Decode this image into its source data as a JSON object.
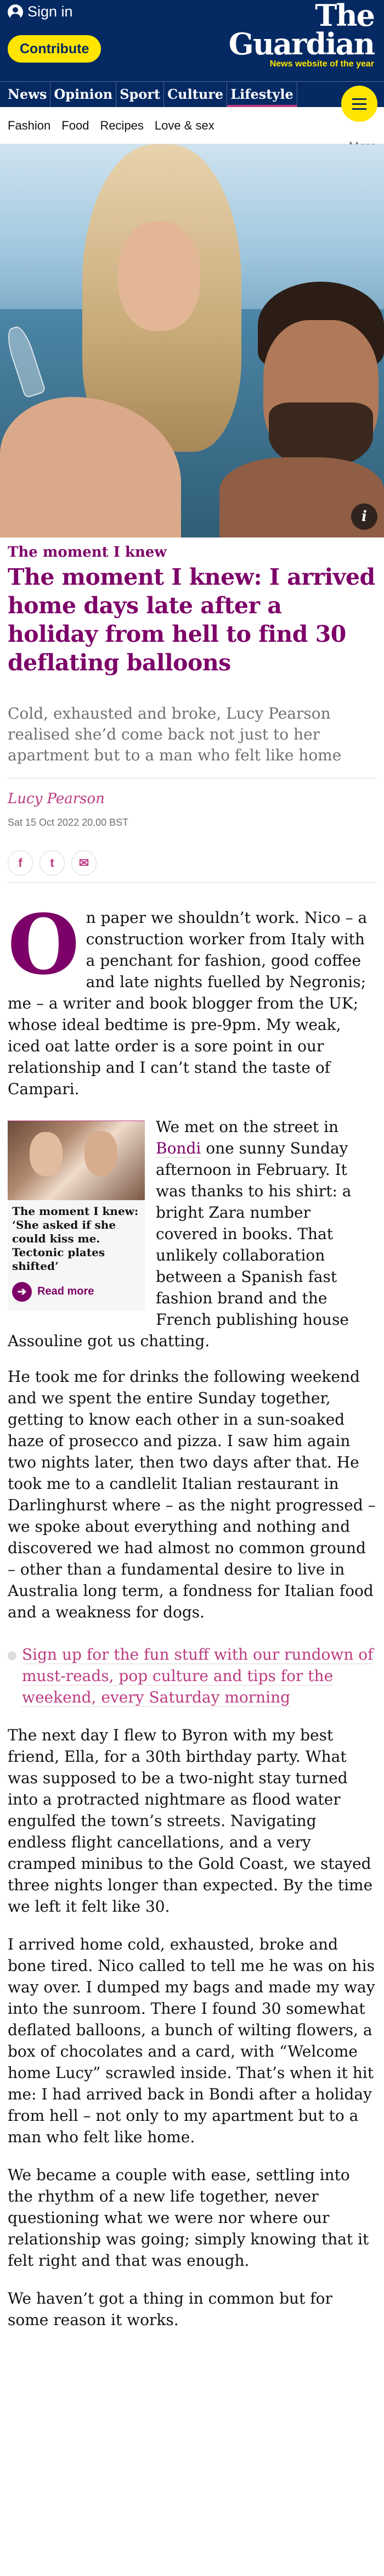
{
  "header": {
    "signin_label": "Sign in",
    "contribute_label": "Contribute",
    "logo_line1": "The",
    "logo_line2": "Guardian",
    "logo_tagline": "News website of the year",
    "nav": [
      "News",
      "Opinion",
      "Sport",
      "Culture",
      "Lifestyle"
    ],
    "active_nav": "Lifestyle",
    "subnav": [
      "Fashion",
      "Food",
      "Recipes",
      "Love & sex"
    ],
    "subnav_more": "More",
    "colors": {
      "brand": "#052962",
      "accent": "#ffe500",
      "lifestyle": "#7d0068"
    }
  },
  "hero": {
    "info_icon": "i"
  },
  "article": {
    "kicker": "The moment I knew",
    "headline": "The moment I knew: I arrived home days late after a holiday from hell to find 30 deflating balloons",
    "standfirst": "Cold, exhausted and broke, Lucy Pearson realised she’d come back not just to her apartment but to a man who felt like home",
    "byline": "Lucy Pearson",
    "date": "Sat 15 Oct 2022 20.00 BST",
    "share_icons": [
      "f",
      "t",
      "✉"
    ],
    "dropcap": "O",
    "p1": "n paper we shouldn’t work. Nico – a construction worker from Italy with a penchant for fashion, good coffee and late nights fuelled by Negronis; me – a writer and book blogger from the UK; whose ideal bedtime is pre-9pm. My weak, iced oat latte order is a sore point in our relationship and I can’t stand the taste of Campari.",
    "rich_link": {
      "title": "The moment I knew: ‘She asked if she could kiss me. Tectonic plates shifted’",
      "more": "Read more"
    },
    "p2_before": "We met on the street in ",
    "p2_link": "Bondi",
    "p2_after": " one sunny Sunday afternoon in February. It was thanks to his shirt: a bright Zara number covered in books. That unlikely collaboration between a Spanish fast fashion brand and the French publishing house Assouline got us chatting.",
    "p3": "He took me for drinks the following weekend and we spent the entire Sunday together, getting to know each other in a sun-soaked haze of prosecco and pizza. I saw him again two nights later, then two days after that. He took me to a candlelit Italian restaurant in Darlinghurst where – as the night progressed – we spoke about everything and nothing and discovered we had almost no common ground – other than a fundamental desire to live in Australia long term, a fondness for Italian food and a weakness for dogs.",
    "signup": "Sign up for the fun stuff with our rundown of must-reads, pop culture and tips for the weekend, every Saturday morning",
    "p4": "The next day I flew to Byron with my best friend, Ella, for a 30th birthday party. What was supposed to be a two-night stay turned into a protracted nightmare as flood water engulfed the town’s streets. Navigating endless flight cancellations, and a very cramped minibus to the Gold Coast, we stayed three nights longer than expected. By the time we left it felt like 30.",
    "p5": "I arrived home cold, exhausted, broke and bone tired. Nico called to tell me he was on his way over. I dumped my bags and made my way into the sunroom. There I found 30 somewhat deflated balloons, a bunch of wilting flowers, a box of chocolates and a card, with “Welcome home Lucy” scrawled inside. That’s when it hit me: I had arrived back in Bondi after a holiday from hell – not only to my apartment but to a man who felt like home.",
    "p6": "We became a couple with ease, settling into the rhythm of a new life together, never questioning what we were nor where our relationship was going; simply knowing that it felt right and that was enough.",
    "p7": "We haven’t got a thing in common but for some reason it works."
  }
}
